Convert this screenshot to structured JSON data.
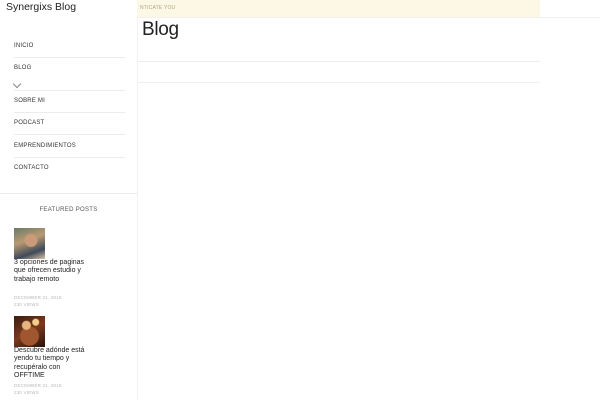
{
  "site": {
    "title": "Synergixs Blog"
  },
  "notice": {
    "text": "NTICATE YOU"
  },
  "page": {
    "title": "Blog"
  },
  "nav": {
    "items": [
      {
        "label": "INICIO"
      },
      {
        "label": "BLOG"
      },
      {
        "label": "SOBRE MI"
      },
      {
        "label": "PODCAST"
      },
      {
        "label": "EMPRENDIMIENTOS"
      },
      {
        "label": "CONTACTO"
      }
    ]
  },
  "featured": {
    "heading": "FEATURED POSTS",
    "posts": [
      {
        "title": "3 opciones de paginas que ofrecen estudio y trabajo remoto",
        "date": "DECEMBER 21, 2018",
        "meta": "230 VIEWS"
      },
      {
        "title": "Descubre adónde está yendo tu tiempo y recupéralo con OFFTIME",
        "date": "DECEMBER 21, 2018",
        "meta": "230 VIEWS"
      }
    ]
  },
  "colors": {
    "notice_bg": "#fdf8e6",
    "text": "#222222",
    "muted": "#b8b8b8"
  }
}
